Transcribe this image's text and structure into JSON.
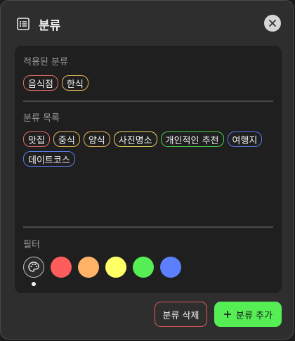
{
  "dialog": {
    "title": "분류",
    "title_icon": "list-icon",
    "close_icon": "close-icon"
  },
  "applied": {
    "label": "적용된 분류",
    "chips": [
      {
        "label": "음식점",
        "color": "#e86a6a"
      },
      {
        "label": "한식",
        "color": "#e8b45a"
      }
    ]
  },
  "list": {
    "label": "분류 목록",
    "chips": [
      {
        "label": "맛집",
        "color": "#e86a6a"
      },
      {
        "label": "중식",
        "color": "#e8b45a"
      },
      {
        "label": "양식",
        "color": "#e8b45a"
      },
      {
        "label": "사진명소",
        "color": "#e8d75a"
      },
      {
        "label": "개인적인 추천",
        "color": "#4ad04a"
      },
      {
        "label": "여행지",
        "color": "#5a7ae8"
      },
      {
        "label": "데이트코스",
        "color": "#5a7ae8"
      }
    ]
  },
  "filter": {
    "label": "필터",
    "palette_icon": "palette-icon",
    "colors": [
      {
        "name": "red",
        "hex": "#ff5c5c"
      },
      {
        "name": "orange",
        "hex": "#ffb366"
      },
      {
        "name": "yellow",
        "hex": "#ffff66"
      },
      {
        "name": "green",
        "hex": "#55ee55"
      },
      {
        "name": "blue",
        "hex": "#5b7fff"
      }
    ]
  },
  "actions": {
    "delete_label": "분류 삭제",
    "add_label": "분류 추가",
    "add_icon": "plus-icon"
  }
}
